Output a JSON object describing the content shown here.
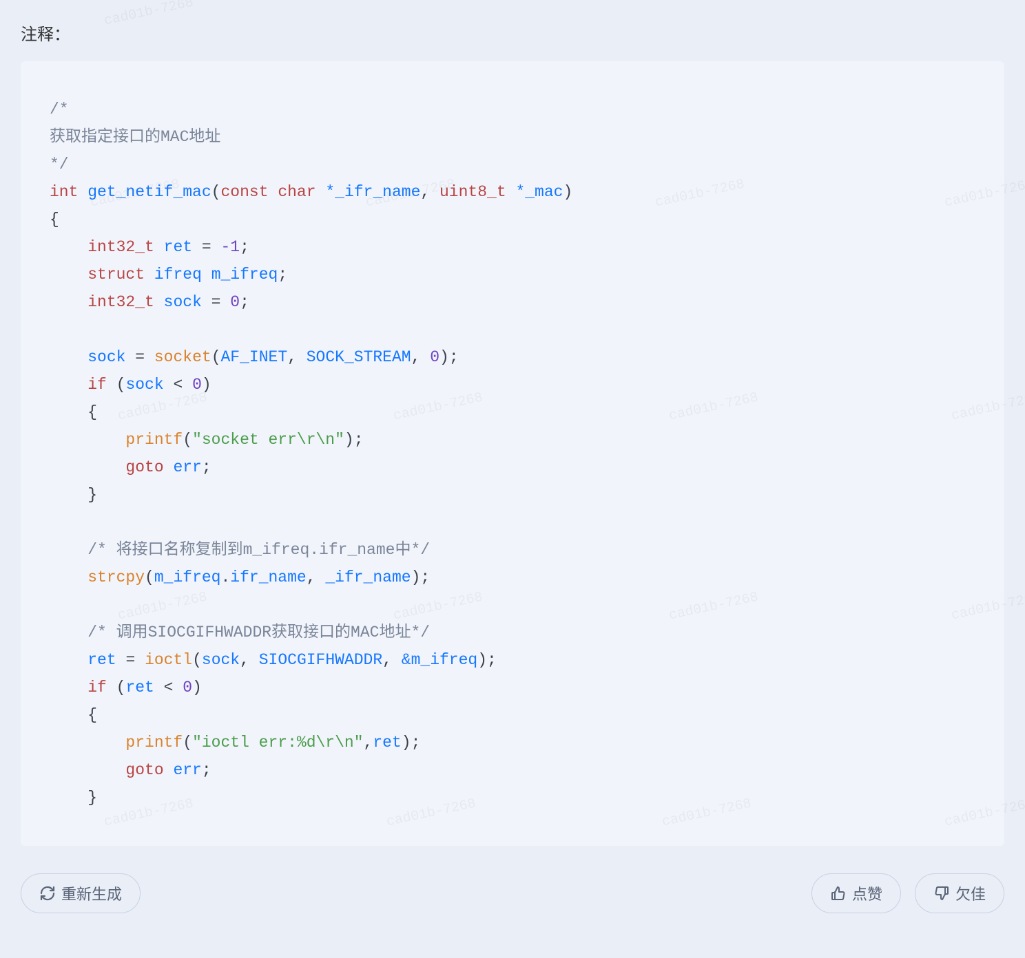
{
  "title": "注释：",
  "watermark": "cad01b-7268",
  "buttons": {
    "regenerate": "重新生成",
    "like": "点赞",
    "dislike": "欠佳"
  },
  "code": {
    "lines": [
      {
        "t": "cm",
        "s": "/*"
      },
      {
        "t": "cm",
        "s": "获取指定接口的MAC地址"
      },
      {
        "t": "cm",
        "s": "*/"
      },
      {
        "t": "sig",
        "parts": [
          "int",
          " ",
          "get_netif_mac",
          "(",
          "const",
          " ",
          "char",
          " ",
          "*_ifr_name",
          ",",
          " ",
          "uint8_t",
          " ",
          "*_mac",
          ")"
        ]
      },
      {
        "t": "brace",
        "s": "{"
      },
      {
        "t": "decl",
        "indent": 1,
        "parts": [
          "int32_t",
          " ",
          "ret",
          " = ",
          "-1",
          ";"
        ]
      },
      {
        "t": "decl",
        "indent": 1,
        "parts": [
          "struct",
          " ",
          "ifreq",
          " ",
          "m_ifreq",
          ";"
        ]
      },
      {
        "t": "decl",
        "indent": 1,
        "parts": [
          "int32_t",
          " ",
          "sock",
          " = ",
          "0",
          ";"
        ]
      },
      {
        "t": "blank"
      },
      {
        "t": "stmt",
        "indent": 1,
        "parts": [
          "sock",
          " = ",
          "socket",
          "(",
          "AF_INET",
          ",",
          " ",
          "SOCK_STREAM",
          ",",
          " ",
          "0",
          ")",
          ";"
        ]
      },
      {
        "t": "if",
        "indent": 1,
        "parts": [
          "if",
          " (",
          "sock",
          " < ",
          "0",
          ")"
        ]
      },
      {
        "t": "brace",
        "indent": 1,
        "s": "{"
      },
      {
        "t": "call",
        "indent": 2,
        "parts": [
          "printf",
          "(",
          "\"socket err\\r\\n\"",
          ")",
          ";"
        ]
      },
      {
        "t": "goto",
        "indent": 2,
        "parts": [
          "goto",
          " ",
          "err",
          ";"
        ]
      },
      {
        "t": "brace",
        "indent": 1,
        "s": "}"
      },
      {
        "t": "blank"
      },
      {
        "t": "cm",
        "indent": 1,
        "s": "/* 将接口名称复制到m_ifreq.ifr_name中*/"
      },
      {
        "t": "call",
        "indent": 1,
        "parts": [
          "strcpy",
          "(",
          "m_ifreq",
          ".",
          "ifr_name",
          ",",
          " ",
          "_ifr_name",
          ")",
          ";"
        ]
      },
      {
        "t": "blank"
      },
      {
        "t": "cm",
        "indent": 1,
        "s": "/* 调用SIOCGIFHWADDR获取接口的MAC地址*/"
      },
      {
        "t": "stmt",
        "indent": 1,
        "parts": [
          "ret",
          " = ",
          "ioctl",
          "(",
          "sock",
          ",",
          " ",
          "SIOCGIFHWADDR",
          ",",
          " ",
          "&m_ifreq",
          ")",
          ";"
        ]
      },
      {
        "t": "if",
        "indent": 1,
        "parts": [
          "if",
          " (",
          "ret",
          " < ",
          "0",
          ")"
        ]
      },
      {
        "t": "brace",
        "indent": 1,
        "s": "{"
      },
      {
        "t": "call",
        "indent": 2,
        "parts": [
          "printf",
          "(",
          "\"ioctl err:%d\\r\\n\"",
          ",",
          "ret",
          ")",
          ";"
        ]
      },
      {
        "t": "goto",
        "indent": 2,
        "parts": [
          "goto",
          " ",
          "err",
          ";"
        ]
      },
      {
        "t": "brace",
        "indent": 1,
        "s": "}"
      }
    ]
  }
}
